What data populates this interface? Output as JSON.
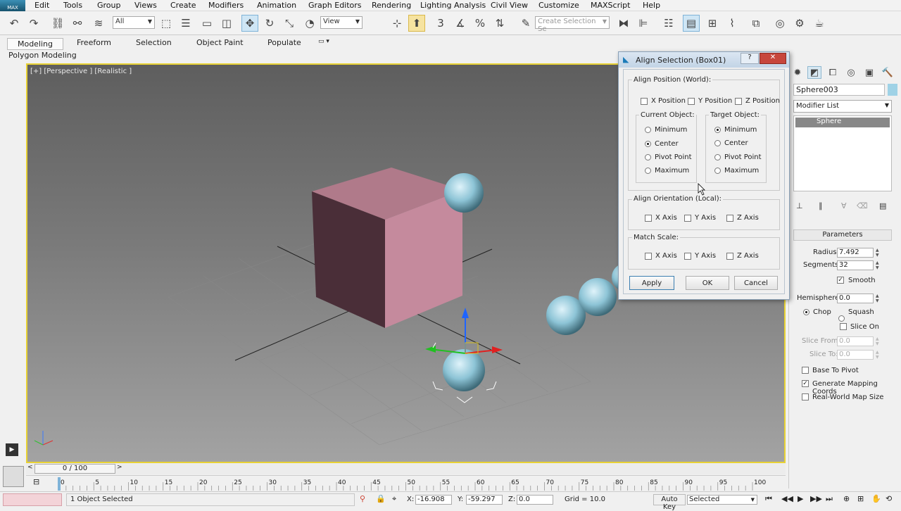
{
  "app": {
    "logo_text": "MAX"
  },
  "menu": [
    "Edit",
    "Tools",
    "Group",
    "Views",
    "Create",
    "Modifiers",
    "Animation",
    "Graph Editors",
    "Rendering",
    "Lighting Analysis",
    "Civil View",
    "Customize",
    "MAXScript",
    "Help"
  ],
  "toolbar": {
    "filter": "All",
    "ref_coord": "View",
    "selection_set_placeholder": "Create Selection Se"
  },
  "ribbon": {
    "tabs": [
      "Modeling",
      "Freeform",
      "Selection",
      "Object Paint",
      "Populate"
    ],
    "subtitle": "Polygon Modeling"
  },
  "viewport": {
    "label": "[+] [Perspective ] [Realistic ]"
  },
  "dialog": {
    "title": "Align Selection (Box01)",
    "align_position_label": "Align Position (World):",
    "position_checks": [
      {
        "label": "X Position",
        "checked": false
      },
      {
        "label": "Y Position",
        "checked": false
      },
      {
        "label": "Z Position",
        "checked": false
      }
    ],
    "current_object_label": "Current Object:",
    "target_object_label": "Target Object:",
    "current_options": [
      {
        "label": "Minimum",
        "selected": false
      },
      {
        "label": "Center",
        "selected": true
      },
      {
        "label": "Pivot Point",
        "selected": false
      },
      {
        "label": "Maximum",
        "selected": false
      }
    ],
    "target_options": [
      {
        "label": "Minimum",
        "selected": true
      },
      {
        "label": "Center",
        "selected": false
      },
      {
        "label": "Pivot Point",
        "selected": false
      },
      {
        "label": "Maximum",
        "selected": false
      }
    ],
    "align_orientation_label": "Align Orientation (Local):",
    "orientation_checks": [
      {
        "label": "X Axis",
        "checked": false
      },
      {
        "label": "Y Axis",
        "checked": false
      },
      {
        "label": "Z Axis",
        "checked": false
      }
    ],
    "match_scale_label": "Match Scale:",
    "scale_checks": [
      {
        "label": "X Axis",
        "checked": false
      },
      {
        "label": "Y Axis",
        "checked": false
      },
      {
        "label": "Z Axis",
        "checked": false
      }
    ],
    "apply": "Apply",
    "ok": "OK",
    "cancel": "Cancel",
    "help_glyph": "?",
    "close_glyph": "✕"
  },
  "command_panel": {
    "object_name": "Sphere003",
    "object_color": "#9fd2e6",
    "modifier_list": "Modifier List",
    "stack_item": "Sphere",
    "parameters_title": "Parameters",
    "radius_label": "Radius:",
    "radius": "7.492",
    "segments_label": "Segments:",
    "segments": "32",
    "smooth_label": "Smooth",
    "smooth": true,
    "hemisphere_label": "Hemisphere:",
    "hemisphere": "0.0",
    "chop_label": "Chop",
    "squash_label": "Squash",
    "chop_selected": true,
    "slice_on_label": "Slice On",
    "slice_on": false,
    "slice_from_label": "Slice From:",
    "slice_from": "0.0",
    "slice_to_label": "Slice To:",
    "slice_to": "0.0",
    "base_to_pivot_label": "Base To Pivot",
    "base_to_pivot": false,
    "gen_mapping_label": "Generate Mapping Coords",
    "gen_mapping": true,
    "real_world_label": "Real-World Map Size",
    "real_world": false
  },
  "timeline": {
    "frame_display": "0 / 100",
    "current_frame": 0,
    "max_frame": 100,
    "ticks": [
      "0",
      "5",
      "10",
      "15",
      "20",
      "25",
      "30",
      "35",
      "40",
      "45",
      "50",
      "55",
      "60",
      "65",
      "70",
      "75",
      "80",
      "85",
      "90",
      "95",
      "100"
    ]
  },
  "status": {
    "selection": "1 Object Selected",
    "x_label": "X:",
    "x": "-16.908",
    "y_label": "Y:",
    "y": "-59.297",
    "z_label": "Z:",
    "z": "0.0",
    "grid": "Grid = 10.0",
    "auto_key": "Auto Key",
    "key_mode": "Selected"
  }
}
